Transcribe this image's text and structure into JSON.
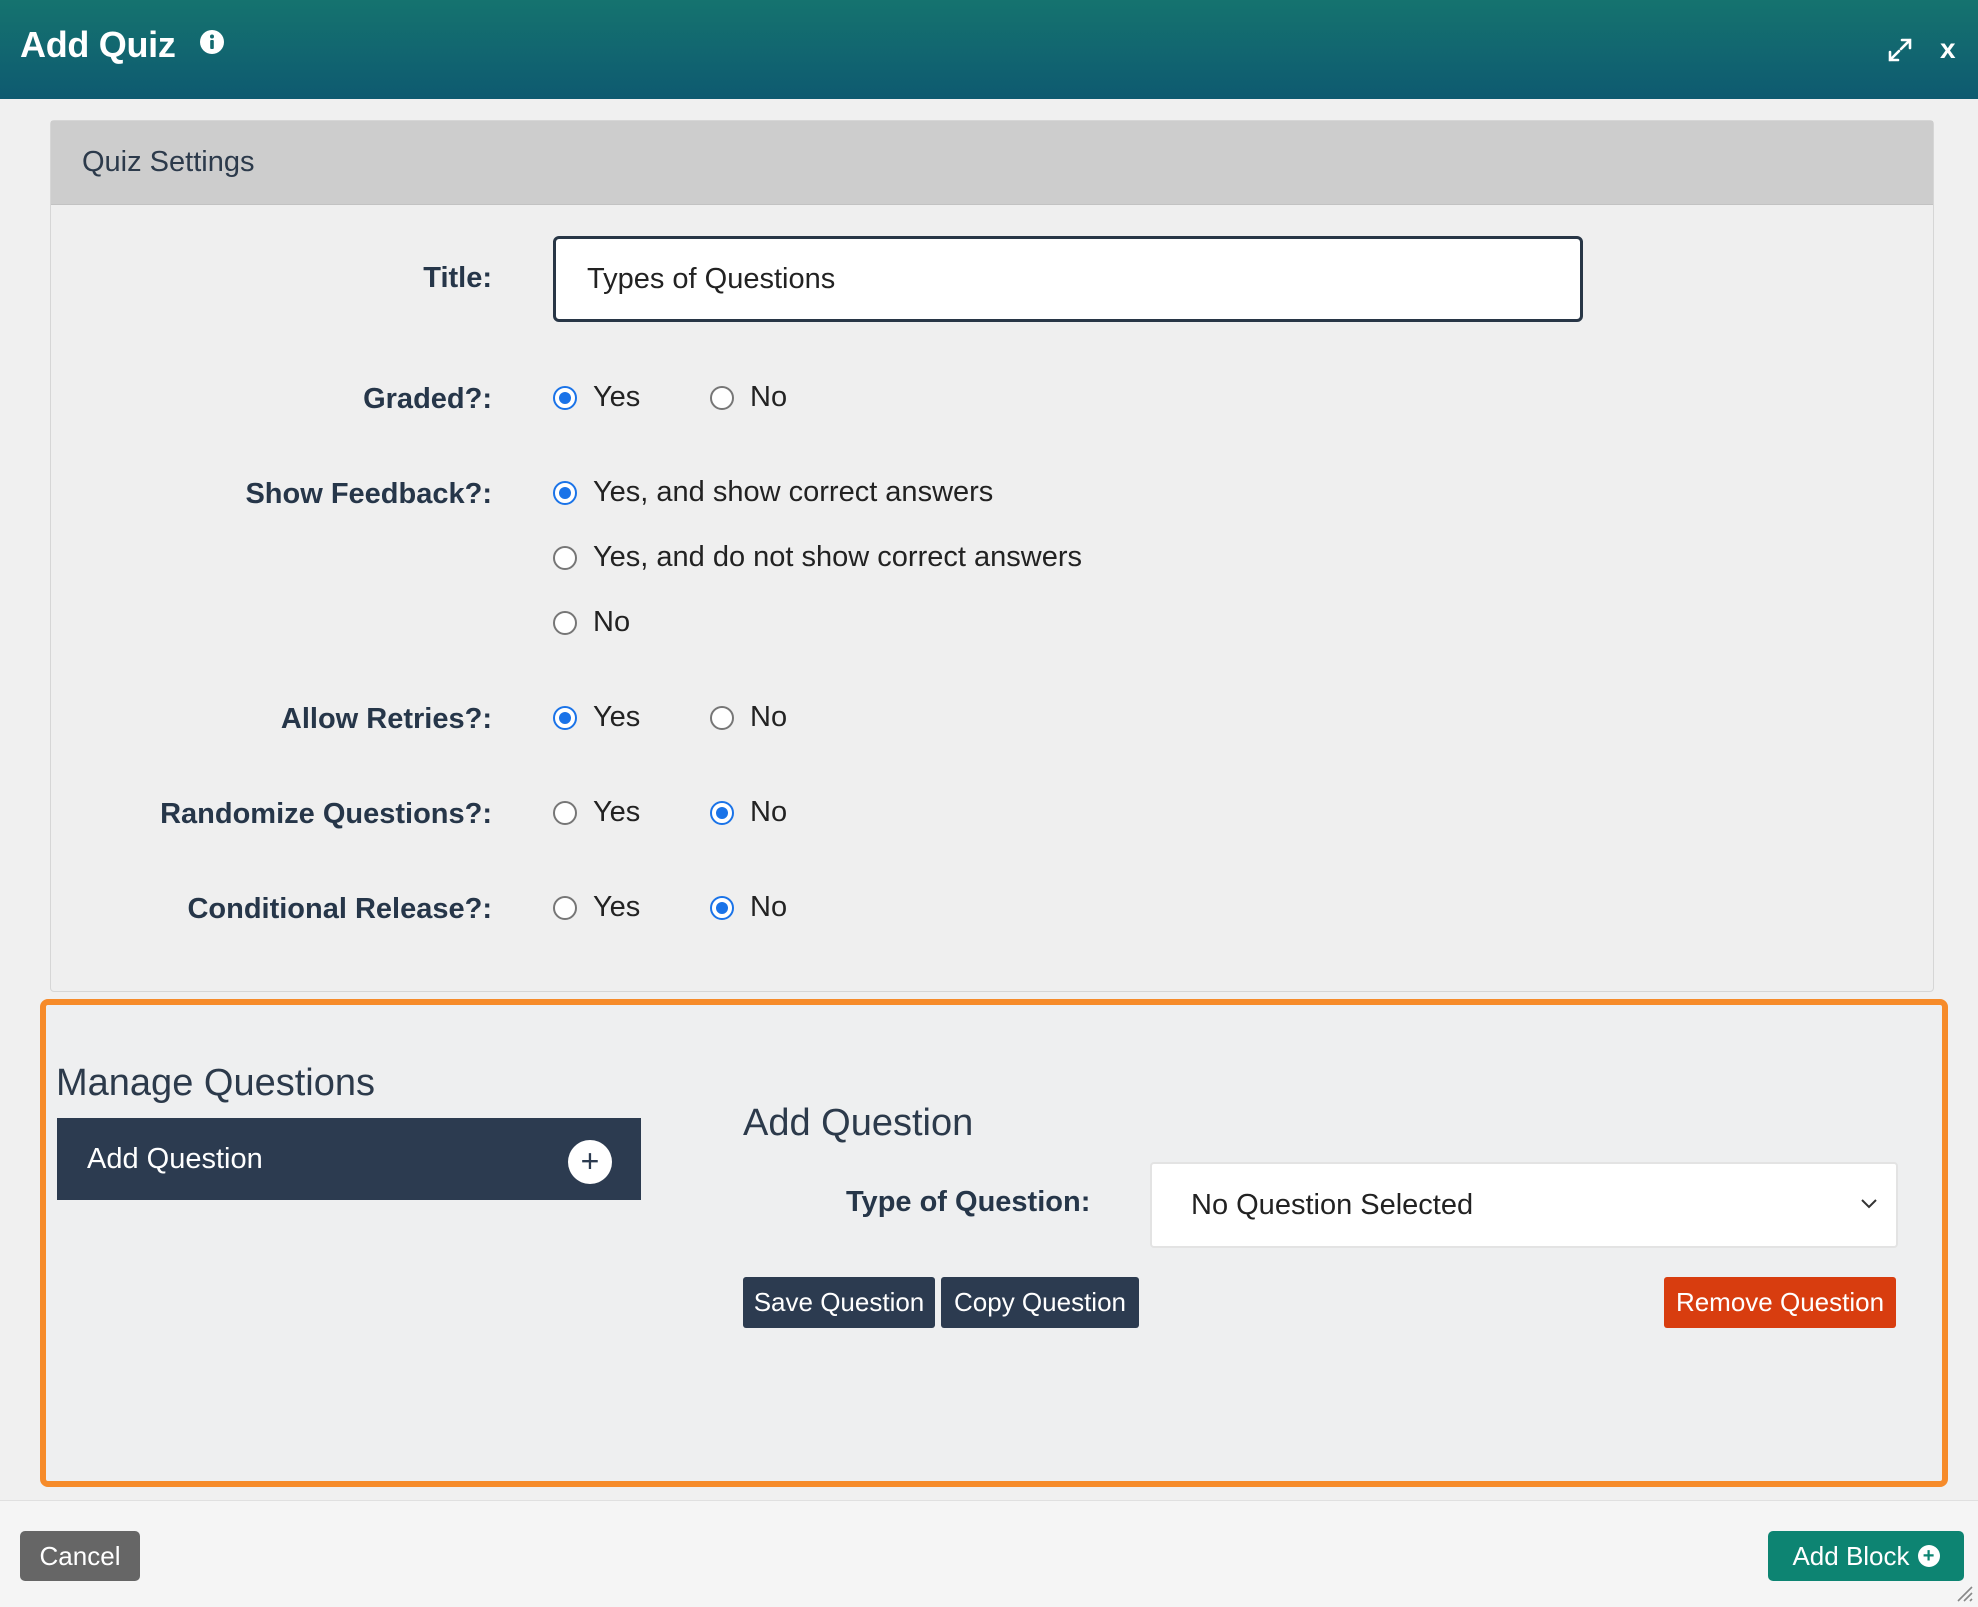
{
  "header": {
    "title": "Add Quiz",
    "close_label": "x"
  },
  "settings": {
    "section_title": "Quiz Settings",
    "title_label": "Title:",
    "title_value": "Types of Questions",
    "graded": {
      "label": "Graded?:",
      "options": [
        "Yes",
        "No"
      ],
      "selected": "Yes"
    },
    "show_feedback": {
      "label": "Show Feedback?:",
      "options": [
        "Yes, and show correct answers",
        "Yes, and do not show correct answers",
        "No"
      ],
      "selected": "Yes, and show correct answers"
    },
    "allow_retries": {
      "label": "Allow Retries?:",
      "options": [
        "Yes",
        "No"
      ],
      "selected": "Yes"
    },
    "randomize": {
      "label": "Randomize Questions?:",
      "options": [
        "Yes",
        "No"
      ],
      "selected": "No"
    },
    "conditional": {
      "label": "Conditional Release?:",
      "options": [
        "Yes",
        "No"
      ],
      "selected": "No"
    }
  },
  "manage": {
    "title": "Manage Questions",
    "add_question_bar": "Add Question",
    "add_question_heading": "Add Question",
    "type_label": "Type of Question:",
    "type_value": "No Question Selected",
    "save_label": "Save Question",
    "copy_label": "Copy Question",
    "remove_label": "Remove Question"
  },
  "footer": {
    "cancel_label": "Cancel",
    "add_block_label": "Add Block"
  },
  "colors": {
    "header": "#15736f",
    "highlight_border": "#f68b2a",
    "remove": "#d83d0f",
    "primary": "#2c3b50",
    "add_block": "#0d8472"
  }
}
